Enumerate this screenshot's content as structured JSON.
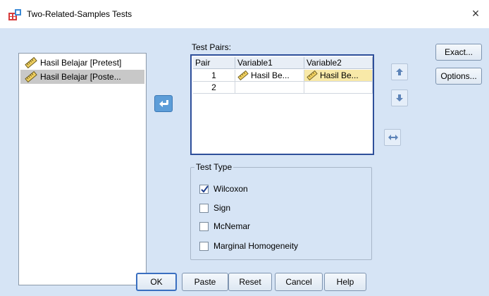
{
  "window": {
    "title": "Two-Related-Samples Tests",
    "close_glyph": "×"
  },
  "variables": [
    {
      "label": "Hasil Belajar [Pretest]",
      "selected": false,
      "icon": "scale-ruler-icon"
    },
    {
      "label": "Hasil Belajar [Poste...",
      "selected": true,
      "icon": "scale-ruler-icon"
    }
  ],
  "test_pairs": {
    "label": "Test Pairs:",
    "columns": [
      "Pair",
      "Variable1",
      "Variable2"
    ],
    "rows": [
      {
        "pair": "1",
        "variable1": "Hasil Be...",
        "variable2": "Hasil Be..."
      },
      {
        "pair": "2",
        "variable1": "",
        "variable2": ""
      }
    ]
  },
  "side_buttons": {
    "exact": "Exact...",
    "options": "Options..."
  },
  "test_type": {
    "legend": "Test Type",
    "options": [
      {
        "label": "Wilcoxon",
        "checked": true
      },
      {
        "label": "Sign",
        "checked": false
      },
      {
        "label": "McNemar",
        "checked": false
      },
      {
        "label": "Marginal Homogeneity",
        "checked": false
      }
    ]
  },
  "buttons": {
    "ok": "OK",
    "paste": "Paste",
    "reset": "Reset",
    "cancel": "Cancel",
    "help": "Help"
  },
  "colors": {
    "dialog_bg": "#d6e4f5",
    "accent": "#5d9dd8",
    "selection_yellow": "#f8e9a8",
    "table_border": "#2e4f9a"
  }
}
